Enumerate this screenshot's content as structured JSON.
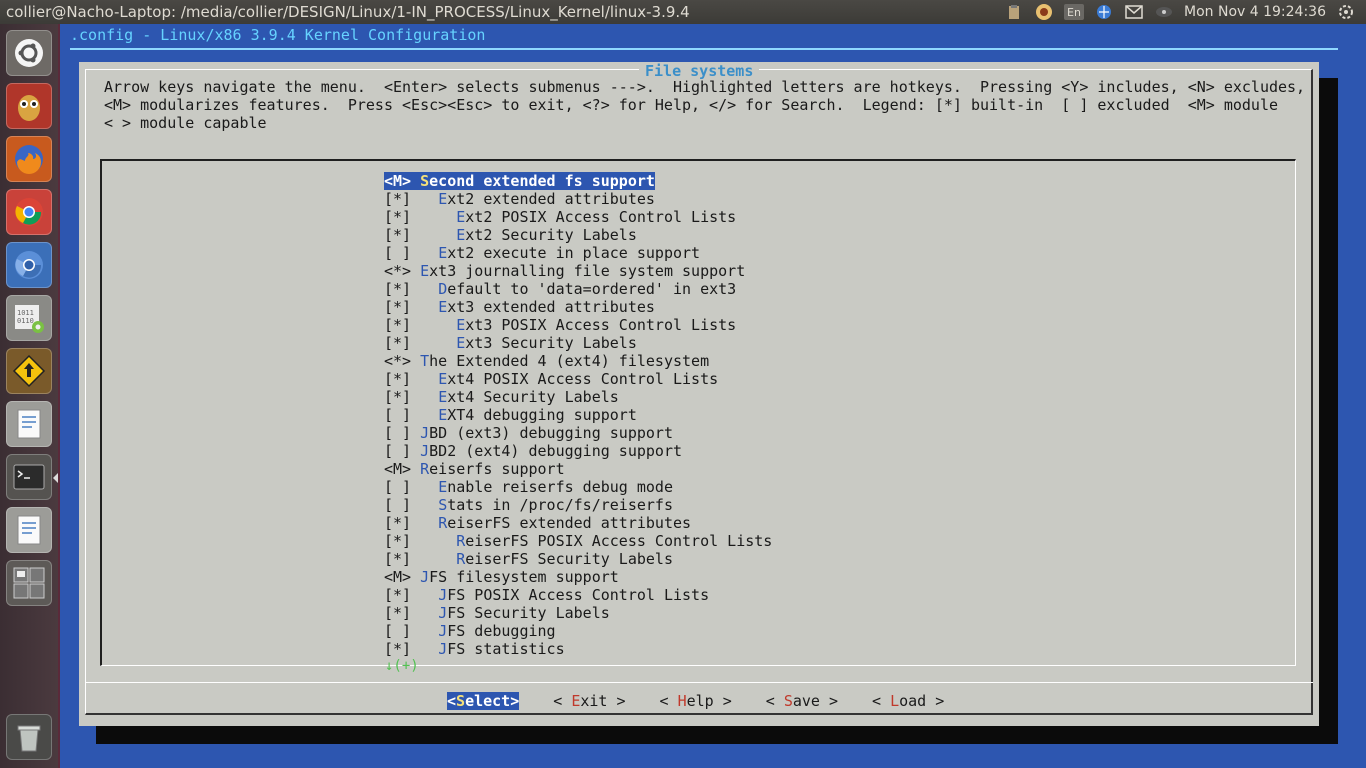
{
  "top_panel": {
    "window_title": "collier@Nacho-Laptop: /media/collier/DESIGN/Linux/1-IN_PROCESS/Linux_Kernel/linux-3.9.4",
    "keyboard_layout": "En",
    "clock": "Mon Nov  4  19:24:36"
  },
  "launcher": {
    "items": [
      {
        "name": "dash-home",
        "icon": "ubuntu-logo-icon"
      },
      {
        "name": "owl-app",
        "icon": "owl-icon"
      },
      {
        "name": "firefox",
        "icon": "firefox-icon"
      },
      {
        "name": "chrome",
        "icon": "chrome-icon"
      },
      {
        "name": "chromium",
        "icon": "chromium-icon"
      },
      {
        "name": "binary-settings",
        "icon": "binary-gear-icon"
      },
      {
        "name": "update-manager",
        "icon": "update-arrow-icon"
      },
      {
        "name": "text-editor",
        "icon": "document-icon"
      },
      {
        "name": "terminal",
        "icon": "terminal-icon"
      },
      {
        "name": "text-editor-2",
        "icon": "document-icon"
      },
      {
        "name": "workspace-switcher",
        "icon": "workspaces-icon"
      },
      {
        "name": "trash",
        "icon": "trash-icon"
      }
    ]
  },
  "terminal": {
    "header_title": ".config - Linux/x86 3.9.4 Kernel Configuration"
  },
  "dialog": {
    "title": "File systems",
    "help_lines": [
      "Arrow keys navigate the menu.  <Enter> selects submenus --->.  Highlighted letters are hotkeys.  Pressing <Y> includes, <N> excludes,",
      "<M> modularizes features.  Press <Esc><Esc> to exit, <?> for Help, </> for Search.  Legend: [*] built-in  [ ] excluded  <M> module",
      "< > module capable"
    ],
    "more_indicator": "↓(+)"
  },
  "menu_items": [
    {
      "state": "<M>",
      "indent": " ",
      "hotkey": "S",
      "rest": "econd extended fs support",
      "selected": true
    },
    {
      "state": "[*]",
      "indent": "   ",
      "hotkey": "E",
      "rest": "xt2 extended attributes"
    },
    {
      "state": "[*]",
      "indent": "     ",
      "hotkey": "E",
      "rest": "xt2 POSIX Access Control Lists"
    },
    {
      "state": "[*]",
      "indent": "     ",
      "hotkey": "E",
      "rest": "xt2 Security Labels"
    },
    {
      "state": "[ ]",
      "indent": "   ",
      "hotkey": "E",
      "rest": "xt2 execute in place support"
    },
    {
      "state": "<*>",
      "indent": " ",
      "hotkey": "E",
      "rest": "xt3 journalling file system support"
    },
    {
      "state": "[*]",
      "indent": "   ",
      "hotkey": "D",
      "rest": "efault to 'data=ordered' in ext3"
    },
    {
      "state": "[*]",
      "indent": "   ",
      "hotkey": "E",
      "rest": "xt3 extended attributes"
    },
    {
      "state": "[*]",
      "indent": "     ",
      "hotkey": "E",
      "rest": "xt3 POSIX Access Control Lists"
    },
    {
      "state": "[*]",
      "indent": "     ",
      "hotkey": "E",
      "rest": "xt3 Security Labels"
    },
    {
      "state": "<*>",
      "indent": " ",
      "hotkey": "T",
      "rest": "he Extended 4 (ext4) filesystem"
    },
    {
      "state": "[*]",
      "indent": "   ",
      "hotkey": "E",
      "rest": "xt4 POSIX Access Control Lists"
    },
    {
      "state": "[*]",
      "indent": "   ",
      "hotkey": "E",
      "rest": "xt4 Security Labels"
    },
    {
      "state": "[ ]",
      "indent": "   ",
      "hotkey": "E",
      "rest": "XT4 debugging support"
    },
    {
      "state": "[ ]",
      "indent": " ",
      "hotkey": "J",
      "rest": "BD (ext3) debugging support"
    },
    {
      "state": "[ ]",
      "indent": " ",
      "hotkey": "J",
      "rest": "BD2 (ext4) debugging support"
    },
    {
      "state": "<M>",
      "indent": " ",
      "hotkey": "R",
      "rest": "eiserfs support"
    },
    {
      "state": "[ ]",
      "indent": "   ",
      "hotkey": "E",
      "rest": "nable reiserfs debug mode"
    },
    {
      "state": "[ ]",
      "indent": "   ",
      "hotkey": "S",
      "rest": "tats in /proc/fs/reiserfs"
    },
    {
      "state": "[*]",
      "indent": "   ",
      "hotkey": "R",
      "rest": "eiserFS extended attributes"
    },
    {
      "state": "[*]",
      "indent": "     ",
      "hotkey": "R",
      "rest": "eiserFS POSIX Access Control Lists"
    },
    {
      "state": "[*]",
      "indent": "     ",
      "hotkey": "R",
      "rest": "eiserFS Security Labels"
    },
    {
      "state": "<M>",
      "indent": " ",
      "hotkey": "J",
      "rest": "FS filesystem support"
    },
    {
      "state": "[*]",
      "indent": "   ",
      "hotkey": "J",
      "rest": "FS POSIX Access Control Lists"
    },
    {
      "state": "[*]",
      "indent": "   ",
      "hotkey": "J",
      "rest": "FS Security Labels"
    },
    {
      "state": "[ ]",
      "indent": "   ",
      "hotkey": "J",
      "rest": "FS debugging"
    },
    {
      "state": "[*]",
      "indent": "   ",
      "hotkey": "J",
      "rest": "FS statistics"
    }
  ],
  "buttons": [
    {
      "pre": "<",
      "hotkey": "S",
      "rest": "elect>",
      "selected": true,
      "name": "select-button"
    },
    {
      "pre": "< ",
      "hotkey": "E",
      "rest": "xit >",
      "name": "exit-button"
    },
    {
      "pre": "< ",
      "hotkey": "H",
      "rest": "elp >",
      "name": "help-button"
    },
    {
      "pre": "< ",
      "hotkey": "S",
      "rest": "ave >",
      "name": "save-button"
    },
    {
      "pre": "< ",
      "hotkey": "L",
      "rest": "oad >",
      "name": "load-button"
    }
  ],
  "colors": {
    "terminal_bg": "#2d56b0",
    "dialog_bg": "#c9cac4",
    "hotkey": "#2d56b0",
    "button_hotkey": "#c0392b",
    "title": "#3b8fc9"
  }
}
